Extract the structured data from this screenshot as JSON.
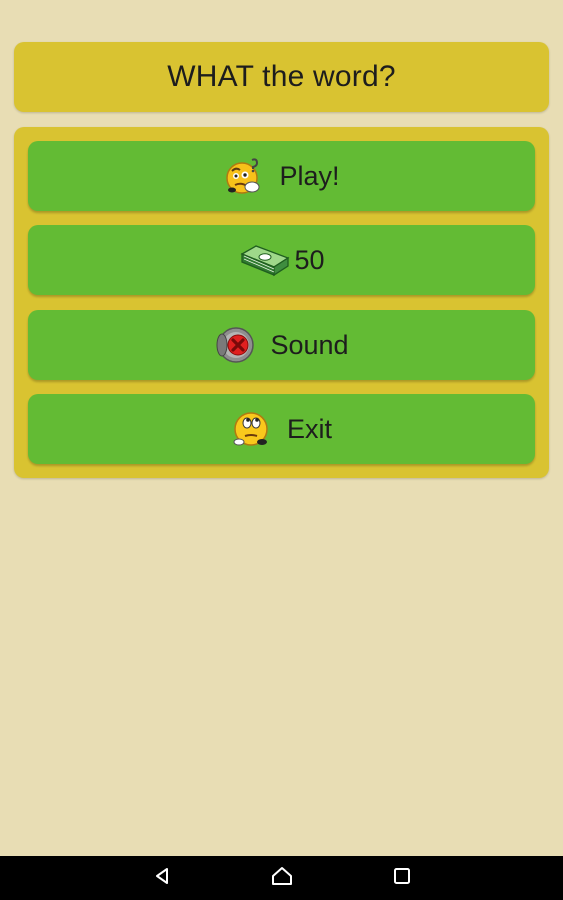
{
  "header": {
    "title": "WHAT the word?"
  },
  "menu": {
    "items": [
      {
        "id": "play",
        "label": "Play!",
        "icon": "thinking-face-icon"
      },
      {
        "id": "coins",
        "label": "50",
        "icon": "money-stack-icon"
      },
      {
        "id": "sound",
        "label": "Sound",
        "icon": "speaker-muted-icon"
      },
      {
        "id": "exit",
        "label": "Exit",
        "icon": "rolling-eyes-face-icon"
      }
    ]
  },
  "navigation": {
    "buttons": [
      "back-icon",
      "home-icon",
      "recents-icon"
    ]
  },
  "colors": {
    "background": "#e8ddb4",
    "panel": "#d9c331",
    "button": "#63bb34",
    "nav_bar": "#000000"
  }
}
